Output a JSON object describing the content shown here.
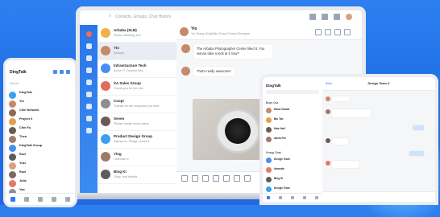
{
  "laptop": {
    "search_placeholder": "Contacts, Groups, Chat History",
    "conversations": [
      {
        "name": "Arbaba (SLB)",
        "preview": "Pesan: Meeting at 3",
        "time": "",
        "color": "#f2b04a"
      },
      {
        "name": "Yio",
        "preview": "[Image]",
        "time": "",
        "color": "#c68a6a"
      },
      {
        "name": "Infrastructure Tech",
        "preview": "Acme IT Connect this",
        "time": "",
        "color": "#4a8df0"
      },
      {
        "name": "XA Sales Group",
        "preview": "Thank you for the info",
        "time": "",
        "color": "#e36a5e"
      },
      {
        "name": "Coopi",
        "preview": "Thanks for the response you sent",
        "time": "",
        "color": "#8e8e8e"
      },
      {
        "name": "Seven",
        "preview": "Please create some ideas",
        "time": "",
        "color": "#6a5a52"
      },
      {
        "name": "Product Design Group",
        "preview": "Awesome, Design check it",
        "time": "",
        "color": "#3aa0f0"
      },
      {
        "name": "Ying",
        "preview": "I will take it",
        "time": "",
        "color": "#a07a66"
      },
      {
        "name": "Bing Ki",
        "preview": "Okay, and thanks",
        "time": "",
        "color": "#5c5c5c"
      }
    ],
    "chat": {
      "title": "Yio",
      "subtitle": "Yio Zhang (DingTalk) Group Product Designer",
      "messages": [
        {
          "text": "The Arbaba Photographer Center liked it. You wanna take a look at it now?"
        },
        {
          "text": "That's really awesome!"
        }
      ]
    }
  },
  "phone": {
    "title": "DingTalk",
    "search_placeholder": "Search",
    "conversations": [
      {
        "name": "DingTalk",
        "preview": "",
        "time": "",
        "color": "#3aa0f0"
      },
      {
        "name": "Yio",
        "preview": "",
        "time": "",
        "color": "#c68a6a"
      },
      {
        "name": "Chin Network",
        "preview": "",
        "time": "",
        "color": "#8a6a5a"
      },
      {
        "name": "Project X",
        "preview": "",
        "time": "",
        "color": "#e3a04a"
      },
      {
        "name": "Chin Fu",
        "preview": "",
        "time": "",
        "color": "#6a5a52"
      },
      {
        "name": "Thea",
        "preview": "",
        "time": "",
        "color": "#a07a66"
      },
      {
        "name": "DingTalk Group",
        "preview": "",
        "time": "",
        "color": "#4a8df0"
      },
      {
        "name": "Ruel",
        "preview": "",
        "time": "",
        "color": "#5c5c5c"
      },
      {
        "name": "Yuki",
        "preview": "",
        "time": "",
        "color": "#d9a184"
      },
      {
        "name": "Ruel",
        "preview": "",
        "time": "",
        "color": "#7b6a60"
      },
      {
        "name": "Julia",
        "preview": "",
        "time": "",
        "color": "#e07a6a"
      },
      {
        "name": "Yao",
        "preview": "",
        "time": "",
        "color": "#8e8e8e"
      }
    ]
  },
  "tablet": {
    "title": "DingTalk",
    "chat_title": "Design Team X",
    "back_label": "Back",
    "sections": [
      "Buys Out",
      "Group Chat"
    ],
    "conversations": [
      {
        "name": "Dana Chanel",
        "color": "#c68a6a"
      },
      {
        "name": "Bui Tan",
        "color": "#e3a04a"
      },
      {
        "name": "Kate Hall",
        "color": "#6a5a52"
      },
      {
        "name": "Adela Fee",
        "color": "#a07a66"
      },
      {
        "name": "Design Team",
        "color": "#4a8df0"
      },
      {
        "name": "Amanda",
        "color": "#e07a6a"
      },
      {
        "name": "Bing Ki",
        "color": "#5c5c5c"
      },
      {
        "name": "Design Team",
        "color": "#3aa0f0"
      }
    ]
  },
  "colors": {
    "brand": "#2e7ff0",
    "background": "#1f6fe6"
  }
}
